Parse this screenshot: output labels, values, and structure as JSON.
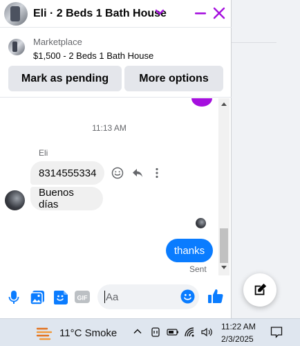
{
  "chat": {
    "header": {
      "title": "Eli · 2 Beds 1 Bath House"
    },
    "marketplace": {
      "label": "Marketplace",
      "listing": "$1,500 - 2 Beds 1 Bath House",
      "pending_button": "Mark as pending",
      "more_button": "More options"
    },
    "thread": {
      "timestamp": "11:13 AM",
      "sender": "Eli",
      "incoming": [
        "8314555334",
        "Buenos días"
      ],
      "outgoing": [
        "thanks"
      ],
      "status": "Sent"
    },
    "composer": {
      "placeholder": "Aa"
    }
  },
  "taskbar": {
    "weather": "11°C  Smoke",
    "time": "11:22 AM",
    "date": "2/3/2025"
  },
  "colors": {
    "accent_purple": "#a50fde",
    "bubble_blue": "#0a7cff",
    "icon_blue": "#0a7cff"
  }
}
